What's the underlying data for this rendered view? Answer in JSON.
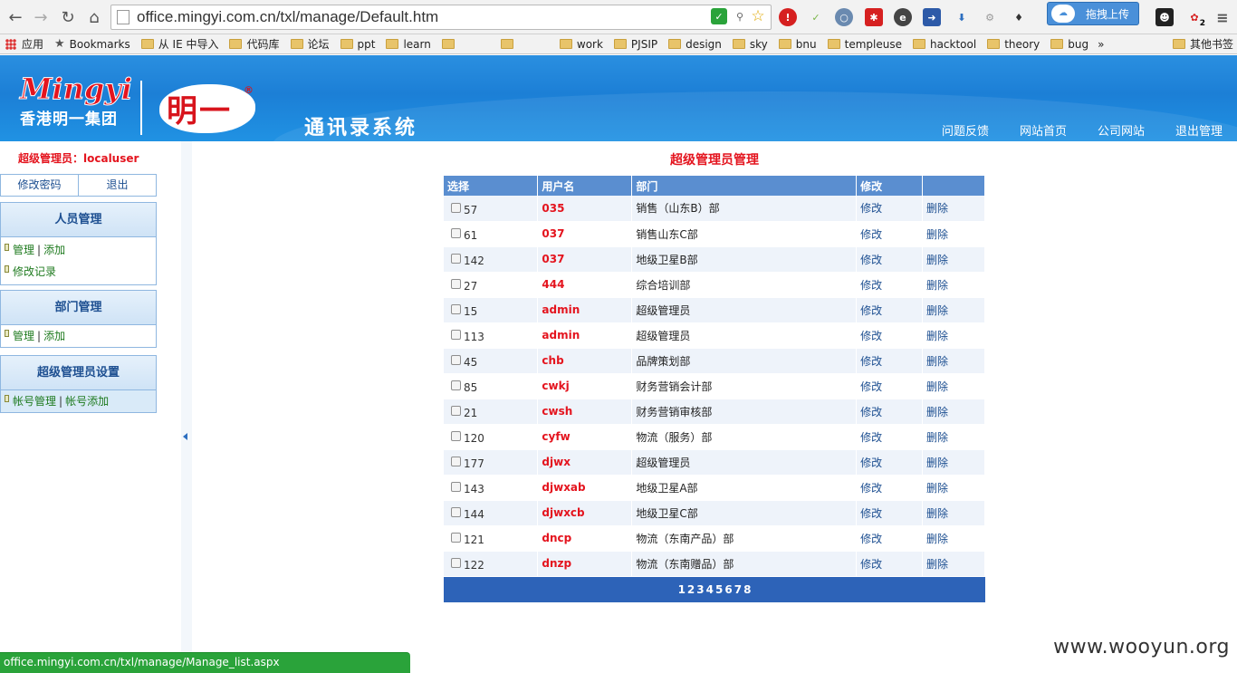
{
  "browser": {
    "url": "office.mingyi.com.cn/txl/manage/Default.htm",
    "upload_label": "拖拽上传",
    "ext_badge": "2",
    "bookmarks": [
      {
        "label": "应用",
        "kind": "apps"
      },
      {
        "label": "Bookmarks",
        "kind": "star"
      },
      {
        "label": "从 IE 中导入",
        "kind": "folder"
      },
      {
        "label": "代码库",
        "kind": "folder"
      },
      {
        "label": "论坛",
        "kind": "folder"
      },
      {
        "label": "ppt",
        "kind": "folder"
      },
      {
        "label": "learn",
        "kind": "folder"
      },
      {
        "label": "",
        "kind": "folder"
      },
      {
        "label": "",
        "kind": "folder"
      },
      {
        "label": "work",
        "kind": "folder"
      },
      {
        "label": "PJSIP",
        "kind": "folder"
      },
      {
        "label": "design",
        "kind": "folder"
      },
      {
        "label": "sky",
        "kind": "folder"
      },
      {
        "label": "bnu",
        "kind": "folder"
      },
      {
        "label": "templeuse",
        "kind": "folder"
      },
      {
        "label": "hacktool",
        "kind": "folder"
      },
      {
        "label": "theory",
        "kind": "folder"
      },
      {
        "label": "bug",
        "kind": "folder"
      }
    ],
    "overflow": "»",
    "other_bookmarks": "其他书签"
  },
  "header": {
    "logo_en": "Mingyi",
    "logo_cn": "香港明一集团",
    "badge": "明一",
    "badge_reg": "®",
    "system_title": "通讯录系统",
    "nav": [
      "问题反馈",
      "网站首页",
      "公司网站",
      "退出管理"
    ]
  },
  "sidebar": {
    "admin_line": "超级管理员：localuser",
    "account_links": [
      "修改密码",
      "退出"
    ],
    "menus": [
      {
        "title": "人员管理",
        "rows": [
          [
            "管理",
            "添加"
          ],
          [
            "修改记录"
          ]
        ]
      },
      {
        "title": "部门管理",
        "rows": [
          [
            "管理",
            "添加"
          ]
        ]
      },
      {
        "title": "超级管理员设置",
        "rows": [
          [
            "帐号管理",
            "帐号添加"
          ]
        ]
      }
    ]
  },
  "main": {
    "title": "超级管理员管理",
    "columns": [
      "选择",
      "用户名",
      "部门",
      "修改",
      ""
    ],
    "edit_label": "修改",
    "delete_label": "删除",
    "rows": [
      {
        "id": "57",
        "user": "035",
        "dept": "销售（山东B）部"
      },
      {
        "id": "61",
        "user": "037",
        "dept": "销售山东C部"
      },
      {
        "id": "142",
        "user": "037",
        "dept": "地级卫星B部"
      },
      {
        "id": "27",
        "user": "444",
        "dept": "综合培训部"
      },
      {
        "id": "15",
        "user": "admin",
        "dept": "超级管理员"
      },
      {
        "id": "113",
        "user": "admin",
        "dept": "超级管理员"
      },
      {
        "id": "45",
        "user": "chb",
        "dept": "品牌策划部"
      },
      {
        "id": "85",
        "user": "cwkj",
        "dept": "财务营销会计部"
      },
      {
        "id": "21",
        "user": "cwsh",
        "dept": "财务营销审核部"
      },
      {
        "id": "120",
        "user": "cyfw",
        "dept": "物流（服务）部"
      },
      {
        "id": "177",
        "user": "djwx",
        "dept": "超级管理员"
      },
      {
        "id": "143",
        "user": "djwxab",
        "dept": "地级卫星A部"
      },
      {
        "id": "144",
        "user": "djwxcb",
        "dept": "地级卫星C部"
      },
      {
        "id": "121",
        "user": "dncp",
        "dept": "物流（东南产品）部"
      },
      {
        "id": "122",
        "user": "dnzp",
        "dept": "物流（东南赠品）部"
      }
    ],
    "pages": [
      "1",
      "2",
      "3",
      "4",
      "5",
      "6",
      "7",
      "8"
    ]
  },
  "status_bar": "office.mingyi.com.cn/txl/manage/Manage_list.aspx",
  "watermark": "www.wooyun.org",
  "colors": {
    "header_blue": "#1c7fd6",
    "accent_red": "#e4141e",
    "table_head": "#5a8ed0",
    "pager": "#2d63b8"
  }
}
